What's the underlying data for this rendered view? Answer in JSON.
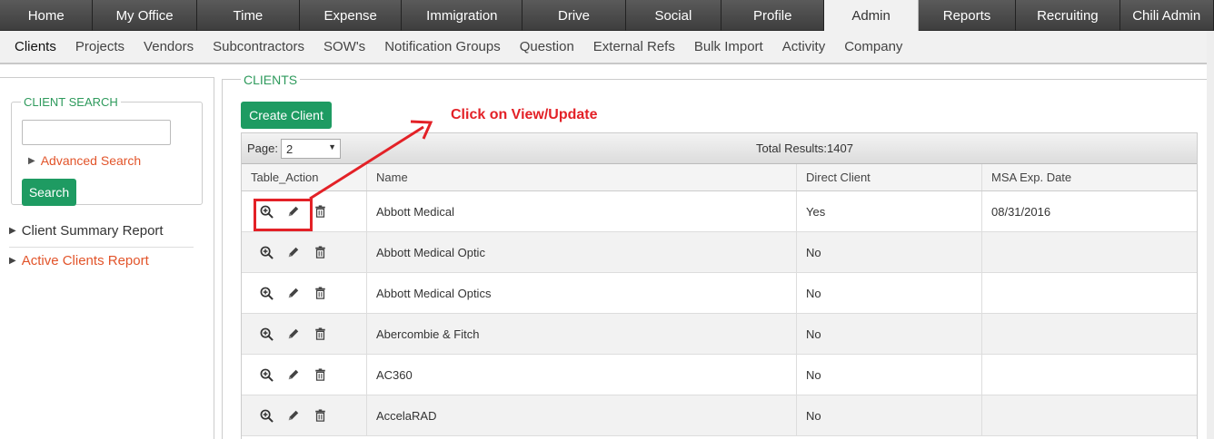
{
  "topnav": [
    {
      "label": "Home",
      "w": 104
    },
    {
      "label": "My Office",
      "w": 116
    },
    {
      "label": "Time",
      "w": 115
    },
    {
      "label": "Expense",
      "w": 114
    },
    {
      "label": "Immigration",
      "w": 135
    },
    {
      "label": "Drive",
      "w": 115
    },
    {
      "label": "Social",
      "w": 107
    },
    {
      "label": "Profile",
      "w": 115
    },
    {
      "label": "Admin",
      "w": 105,
      "active": true
    },
    {
      "label": "Reports",
      "w": 109
    },
    {
      "label": "Recruiting",
      "w": 116
    },
    {
      "label": "Chili Admin",
      "w": 105
    }
  ],
  "subnav": [
    "Clients",
    "Projects",
    "Vendors",
    "Subcontractors",
    "SOW's",
    "Notification Groups",
    "Question",
    "External Refs",
    "Bulk Import",
    "Activity",
    "Company"
  ],
  "left": {
    "search_legend": "CLIENT SEARCH",
    "advanced_search": "Advanced Search",
    "search_button": "Search",
    "summary_report": "Client Summary Report",
    "active_report": "Active Clients Report"
  },
  "main": {
    "legend": "CLIENTS",
    "create_button": "Create Client",
    "page_label": "Page:",
    "page_value": "2",
    "total_results": "Total Results:1407",
    "columns": [
      "Table_Action",
      "Name",
      "Direct Client",
      "MSA Exp. Date"
    ],
    "rows": [
      {
        "name": "Abbott Medical",
        "direct": "Yes",
        "msa": "08/31/2016"
      },
      {
        "name": "Abbott Medical Optic",
        "direct": "No",
        "msa": ""
      },
      {
        "name": "Abbott Medical Optics",
        "direct": "No",
        "msa": ""
      },
      {
        "name": "Abercombie & Fitch",
        "direct": "No",
        "msa": ""
      },
      {
        "name": "AC360",
        "direct": "No",
        "msa": ""
      },
      {
        "name": "AccelaRAD",
        "direct": "No",
        "msa": ""
      }
    ]
  },
  "annotation": {
    "text": "Click on View/Update",
    "color": "#e32127"
  },
  "icons": {
    "view": "zoom-in-icon",
    "edit": "pencil-icon",
    "delete": "trash-icon"
  }
}
